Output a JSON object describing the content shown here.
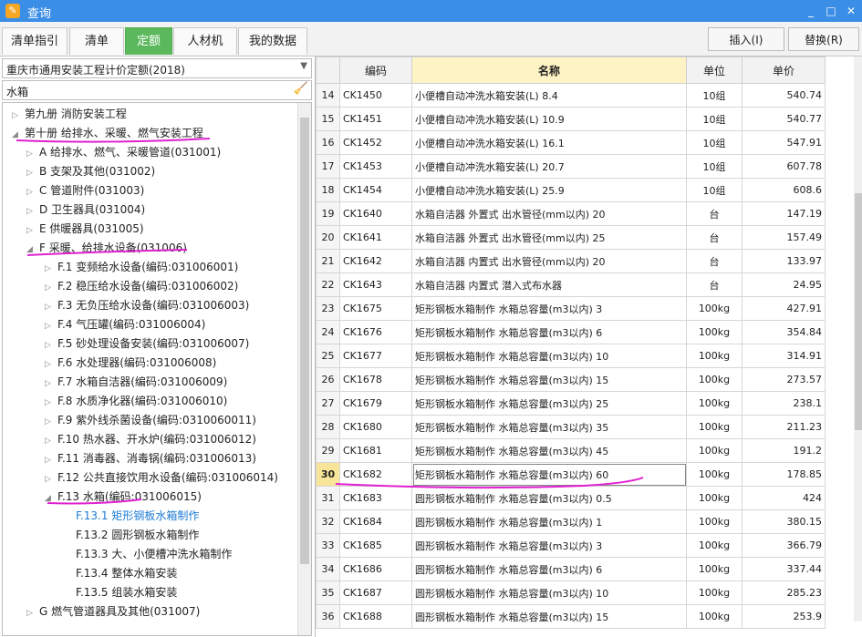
{
  "window": {
    "title": "查询",
    "controls": [
      "_",
      "□",
      "✕"
    ]
  },
  "tabs": [
    {
      "label": "清单指引",
      "active": false
    },
    {
      "label": "清单",
      "active": false
    },
    {
      "label": "定额",
      "active": true
    },
    {
      "label": "人材机",
      "active": false
    },
    {
      "label": "我的数据",
      "active": false
    }
  ],
  "toolbar": {
    "insert_label": "插入(I)",
    "replace_label": "替换(R)"
  },
  "left": {
    "quota_set": "重庆市通用安装工程计价定额(2018)",
    "search_value": "水箱",
    "tree": [
      {
        "label": "第九册 消防安装工程",
        "level": 0,
        "expanded": false
      },
      {
        "label": "第十册 给排水、采暖、燃气安装工程",
        "level": 0,
        "expanded": true
      },
      {
        "label": "A 给排水、燃气、采暖管道(031001)",
        "level": 1,
        "expanded": false
      },
      {
        "label": "B 支架及其他(031002)",
        "level": 1,
        "expanded": false
      },
      {
        "label": "C 管道附件(031003)",
        "level": 1,
        "expanded": false
      },
      {
        "label": "D 卫生器具(031004)",
        "level": 1,
        "expanded": false
      },
      {
        "label": "E 供暖器具(031005)",
        "level": 1,
        "expanded": false
      },
      {
        "label": "F 采暖、给排水设备(031006)",
        "level": 1,
        "expanded": true
      },
      {
        "label": "F.1 变频给水设备(编码:031006001)",
        "level": 2,
        "expanded": false
      },
      {
        "label": "F.2 稳压给水设备(编码:031006002)",
        "level": 2,
        "expanded": false
      },
      {
        "label": "F.3 无负压给水设备(编码:031006003)",
        "level": 2,
        "expanded": false
      },
      {
        "label": "F.4 气压罐(编码:031006004)",
        "level": 2,
        "expanded": false
      },
      {
        "label": "F.5 砂处理设备安装(编码:031006007)",
        "level": 2,
        "expanded": false
      },
      {
        "label": "F.6 水处理器(编码:031006008)",
        "level": 2,
        "expanded": false
      },
      {
        "label": "F.7 水箱自洁器(编码:031006009)",
        "level": 2,
        "expanded": false
      },
      {
        "label": "F.8 水质净化器(编码:031006010)",
        "level": 2,
        "expanded": false
      },
      {
        "label": "F.9 紫外线杀菌设备(编码:0310060011)",
        "level": 2,
        "expanded": false
      },
      {
        "label": "F.10 热水器、开水炉(编码:031006012)",
        "level": 2,
        "expanded": false
      },
      {
        "label": "F.11 消毒器、消毒锅(编码:031006013)",
        "level": 2,
        "expanded": false
      },
      {
        "label": "F.12 公共直接饮用水设备(编码:031006014)",
        "level": 2,
        "expanded": false
      },
      {
        "label": "F.13 水箱(编码:031006015)",
        "level": 2,
        "expanded": true
      },
      {
        "label": "F.13.1 矩形钢板水箱制作",
        "level": 3,
        "selected": true
      },
      {
        "label": "F.13.2 圆形钢板水箱制作",
        "level": 3
      },
      {
        "label": "F.13.3 大、小便槽冲洗水箱制作",
        "level": 3
      },
      {
        "label": "F.13.4 整体水箱安装",
        "level": 3
      },
      {
        "label": "F.13.5 组装水箱安装",
        "level": 3
      },
      {
        "label": "G 燃气管道器具及其他(031007)",
        "level": 1,
        "expanded": false
      }
    ]
  },
  "grid": {
    "headers": {
      "code": "编码",
      "name": "名称",
      "unit": "单位",
      "price": "单价"
    },
    "current_row": "30",
    "rows": [
      {
        "n": "14",
        "code": "CK1450",
        "name": "小便槽自动冲洗水箱安装(L) 8.4",
        "unit": "10组",
        "price": "540.74"
      },
      {
        "n": "15",
        "code": "CK1451",
        "name": "小便槽自动冲洗水箱安装(L) 10.9",
        "unit": "10组",
        "price": "540.77"
      },
      {
        "n": "16",
        "code": "CK1452",
        "name": "小便槽自动冲洗水箱安装(L) 16.1",
        "unit": "10组",
        "price": "547.91"
      },
      {
        "n": "17",
        "code": "CK1453",
        "name": "小便槽自动冲洗水箱安装(L) 20.7",
        "unit": "10组",
        "price": "607.78"
      },
      {
        "n": "18",
        "code": "CK1454",
        "name": "小便槽自动冲洗水箱安装(L) 25.9",
        "unit": "10组",
        "price": "608.6"
      },
      {
        "n": "19",
        "code": "CK1640",
        "name": "水箱自洁器 外置式 出水管径(mm以内) 20",
        "unit": "台",
        "price": "147.19"
      },
      {
        "n": "20",
        "code": "CK1641",
        "name": "水箱自洁器 外置式 出水管径(mm以内) 25",
        "unit": "台",
        "price": "157.49"
      },
      {
        "n": "21",
        "code": "CK1642",
        "name": "水箱自洁器 内置式 出水管径(mm以内) 20",
        "unit": "台",
        "price": "133.97"
      },
      {
        "n": "22",
        "code": "CK1643",
        "name": "水箱自洁器 内置式 潜入式布水器",
        "unit": "台",
        "price": "24.95"
      },
      {
        "n": "23",
        "code": "CK1675",
        "name": "矩形钢板水箱制作 水箱总容量(m3以内) 3",
        "unit": "100kg",
        "price": "427.91"
      },
      {
        "n": "24",
        "code": "CK1676",
        "name": "矩形钢板水箱制作 水箱总容量(m3以内) 6",
        "unit": "100kg",
        "price": "354.84"
      },
      {
        "n": "25",
        "code": "CK1677",
        "name": "矩形钢板水箱制作 水箱总容量(m3以内) 10",
        "unit": "100kg",
        "price": "314.91"
      },
      {
        "n": "26",
        "code": "CK1678",
        "name": "矩形钢板水箱制作 水箱总容量(m3以内) 15",
        "unit": "100kg",
        "price": "273.57"
      },
      {
        "n": "27",
        "code": "CK1679",
        "name": "矩形钢板水箱制作 水箱总容量(m3以内) 25",
        "unit": "100kg",
        "price": "238.1"
      },
      {
        "n": "28",
        "code": "CK1680",
        "name": "矩形钢板水箱制作 水箱总容量(m3以内) 35",
        "unit": "100kg",
        "price": "211.23"
      },
      {
        "n": "29",
        "code": "CK1681",
        "name": "矩形钢板水箱制作 水箱总容量(m3以内) 45",
        "unit": "100kg",
        "price": "191.2"
      },
      {
        "n": "30",
        "code": "CK1682",
        "name": "矩形钢板水箱制作 水箱总容量(m3以内) 60",
        "unit": "100kg",
        "price": "178.85"
      },
      {
        "n": "31",
        "code": "CK1683",
        "name": "圆形钢板水箱制作 水箱总容量(m3以内) 0.5",
        "unit": "100kg",
        "price": "424"
      },
      {
        "n": "32",
        "code": "CK1684",
        "name": "圆形钢板水箱制作 水箱总容量(m3以内) 1",
        "unit": "100kg",
        "price": "380.15"
      },
      {
        "n": "33",
        "code": "CK1685",
        "name": "圆形钢板水箱制作 水箱总容量(m3以内) 3",
        "unit": "100kg",
        "price": "366.79"
      },
      {
        "n": "34",
        "code": "CK1686",
        "name": "圆形钢板水箱制作 水箱总容量(m3以内) 6",
        "unit": "100kg",
        "price": "337.44"
      },
      {
        "n": "35",
        "code": "CK1687",
        "name": "圆形钢板水箱制作 水箱总容量(m3以内) 10",
        "unit": "100kg",
        "price": "285.23"
      },
      {
        "n": "36",
        "code": "CK1688",
        "name": "圆形钢板水箱制作 水箱总容量(m3以内) 15",
        "unit": "100kg",
        "price": "253.9"
      }
    ]
  },
  "colors": {
    "accent": "#5cb85c",
    "titlebar": "#3a8ee6",
    "annotation": "#e020d0",
    "selected_text": "#1e7bd4"
  }
}
